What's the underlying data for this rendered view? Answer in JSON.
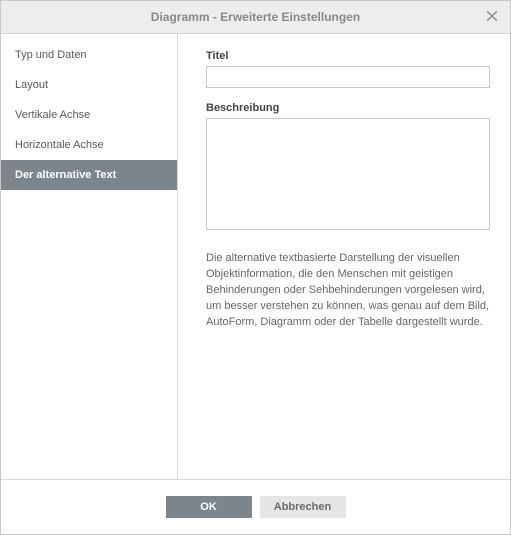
{
  "dialog": {
    "title": "Diagramm - Erweiterte Einstellungen"
  },
  "sidebar": {
    "items": [
      {
        "label": "Typ und Daten",
        "active": false
      },
      {
        "label": "Layout",
        "active": false
      },
      {
        "label": "Vertikale Achse",
        "active": false
      },
      {
        "label": "Horizontale Achse",
        "active": false
      },
      {
        "label": "Der alternative Text",
        "active": true
      }
    ]
  },
  "content": {
    "title_label": "Titel",
    "title_value": "",
    "description_label": "Beschreibung",
    "description_value": "",
    "help_text": "Die alternative textbasierte Darstellung der visuellen Objektinformation, die den Menschen mit geistigen Behinderungen oder Sehbehinderungen vorgelesen wird, um besser verstehen zu können, was genau auf dem Bild, AutoForm, Diagramm oder der Tabelle dargestellt wurde."
  },
  "footer": {
    "ok_label": "OK",
    "cancel_label": "Abbrechen"
  }
}
